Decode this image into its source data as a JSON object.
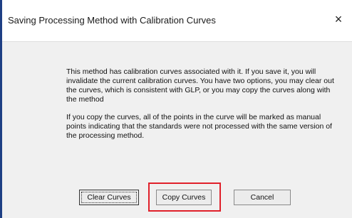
{
  "window": {
    "title": "Saving Processing Method with Calibration Curves",
    "close_glyph": "×"
  },
  "message": {
    "paragraph1": "This method has calibration curves associated with it.  If you save it, you will invalidate the current calibration curves.  You have two options, you may clear out the curves, which is consistent with GLP, or you may copy the curves along with the method",
    "paragraph2": "If you copy the curves, all of the points in the curve will be marked as manual points indicating that the standards were not processed with the same version of the processing method."
  },
  "buttons": {
    "clear_label": "Clear Curves",
    "copy_label": "Copy Curves",
    "cancel_label": "Cancel"
  },
  "colors": {
    "highlight": "#e0202a",
    "dialog_background": "#f0f0f0"
  }
}
